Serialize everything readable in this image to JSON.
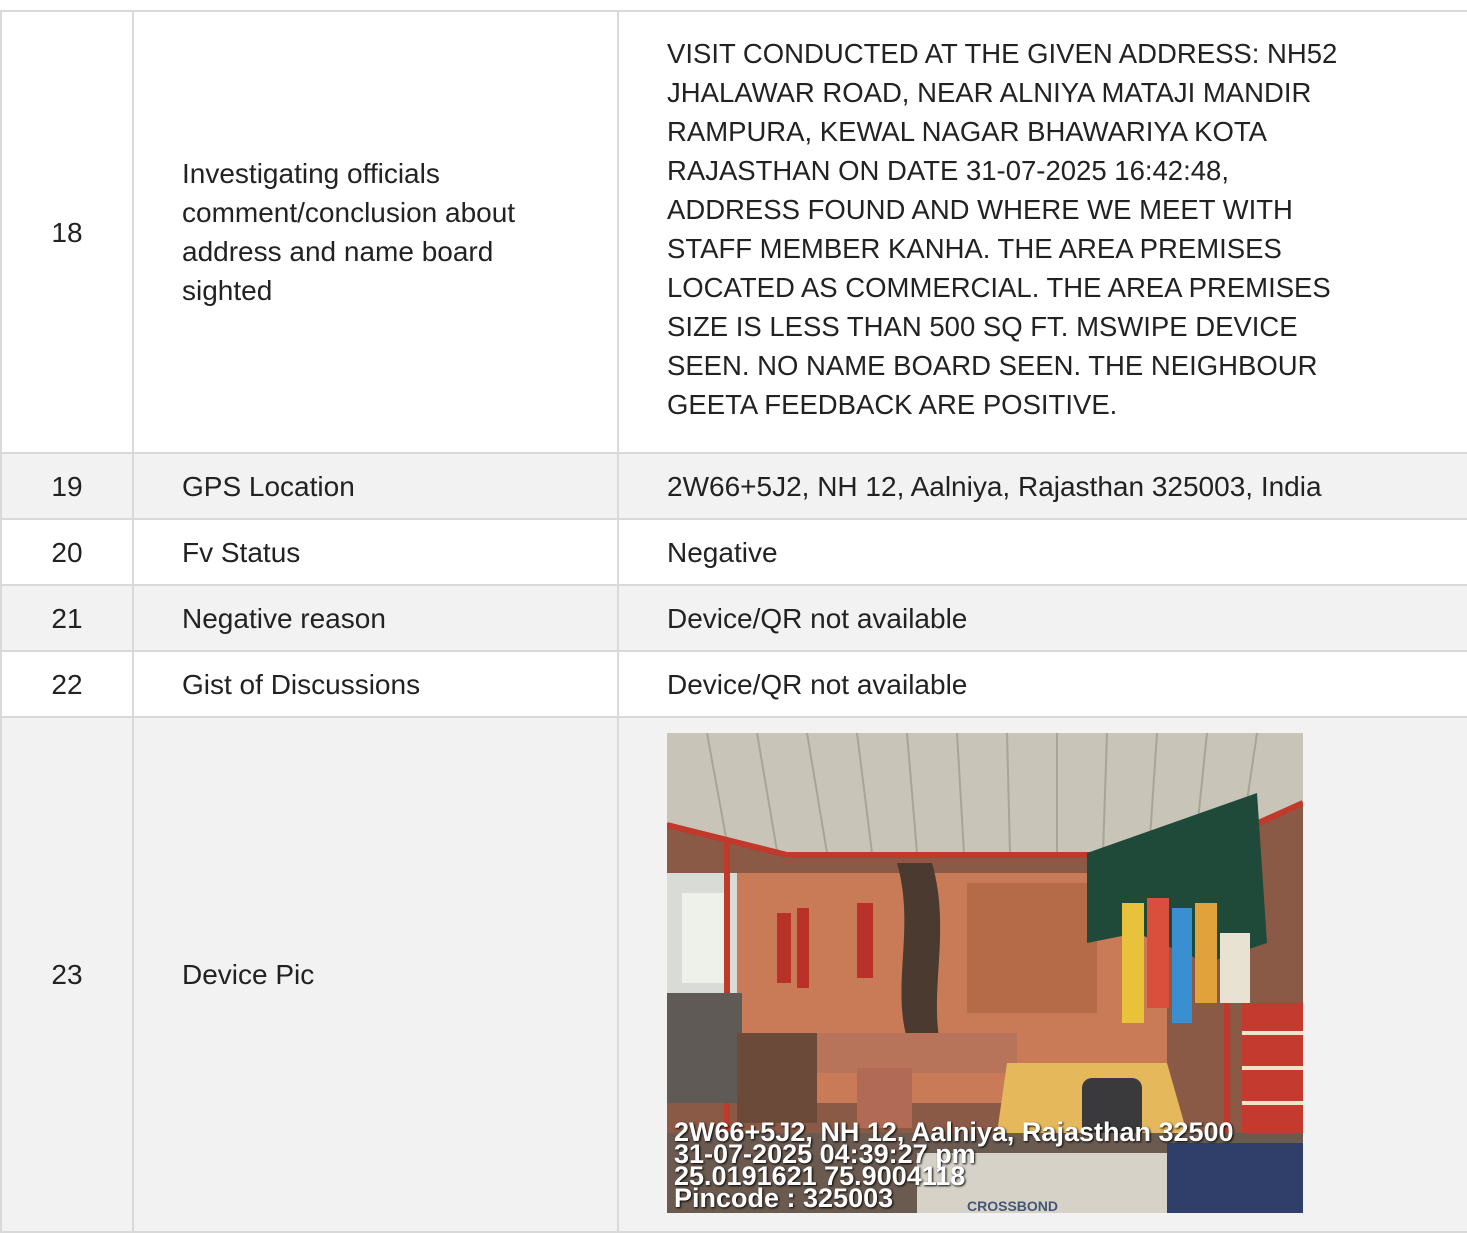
{
  "rows": [
    {
      "no": "18",
      "field_lines": [
        "Investigating officials",
        "comment/conclusion about",
        "address and name board",
        "sighted"
      ],
      "value_lines": [
        "VISIT CONDUCTED AT THE GIVEN ADDRESS: NH52",
        "JHALAWAR ROAD, NEAR ALNIYA MATAJI MANDIR",
        "RAMPURA, KEWAL NAGAR BHAWARIYA KOTA",
        "RAJASTHAN ON DATE 31-07-2025 16:42:48,",
        "ADDRESS FOUND AND WHERE WE MEET WITH",
        "STAFF MEMBER KANHA. THE AREA PREMISES",
        "LOCATED AS COMMERCIAL. THE AREA PREMISES",
        "SIZE IS LESS THAN 500 SQ FT. MSWIPE DEVICE",
        "SEEN. NO NAME BOARD SEEN. THE NEIGHBOUR",
        "GEETA FEEDBACK ARE POSITIVE."
      ]
    },
    {
      "no": "19",
      "field": "GPS Location",
      "value": "2W66+5J2, NH 12, Aalniya, Rajasthan 325003, India"
    },
    {
      "no": "20",
      "field": "Fv Status",
      "value": "Negative"
    },
    {
      "no": "21",
      "field": "Negative reason",
      "value": "Device/QR not available"
    },
    {
      "no": "22",
      "field": "Gist of Discussions",
      "value": "Device/QR not available"
    },
    {
      "no": "23",
      "field": "Device Pic"
    }
  ],
  "photo": {
    "stamp_lines": [
      "2W66+5J2, NH 12, Aalniya, Rajasthan 32500",
      "31-07-2025 04:39:27 pm",
      "25.0191621 75.9004118",
      "Pincode : 325003"
    ],
    "box_text": "CROSSBOND"
  }
}
